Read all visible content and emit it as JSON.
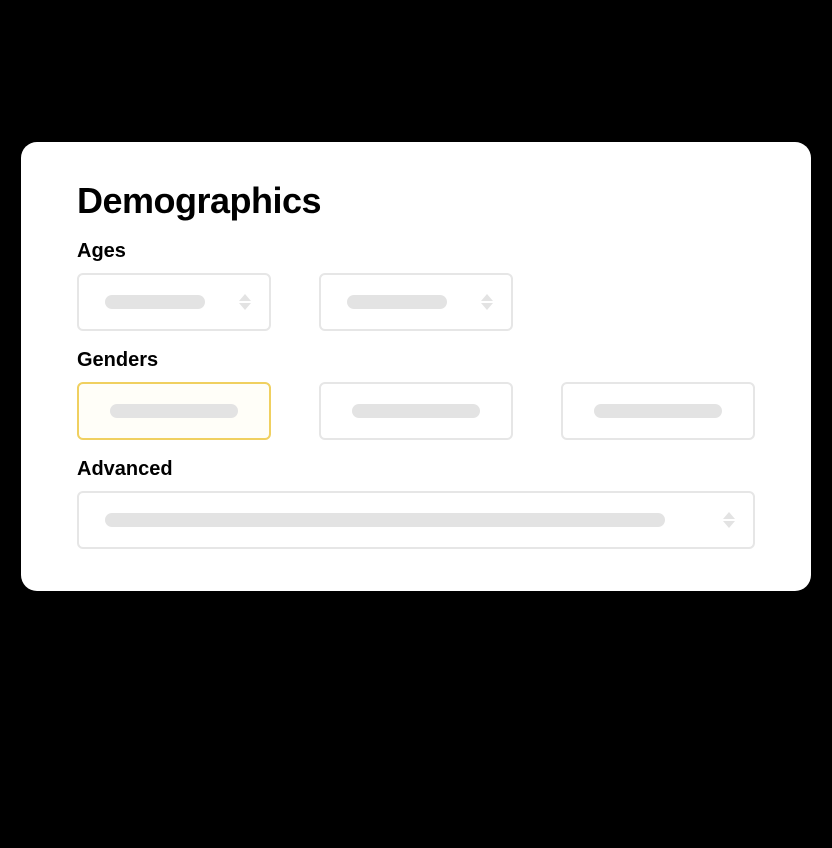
{
  "card": {
    "title": "Demographics",
    "sections": {
      "ages": {
        "label": "Ages",
        "fields": [
          {
            "type": "stepper",
            "value": ""
          },
          {
            "type": "stepper",
            "value": ""
          }
        ]
      },
      "genders": {
        "label": "Genders",
        "options": [
          {
            "value": "",
            "selected": true
          },
          {
            "value": "",
            "selected": false
          },
          {
            "value": "",
            "selected": false
          }
        ]
      },
      "advanced": {
        "label": "Advanced",
        "field": {
          "type": "stepper",
          "value": ""
        }
      }
    }
  }
}
